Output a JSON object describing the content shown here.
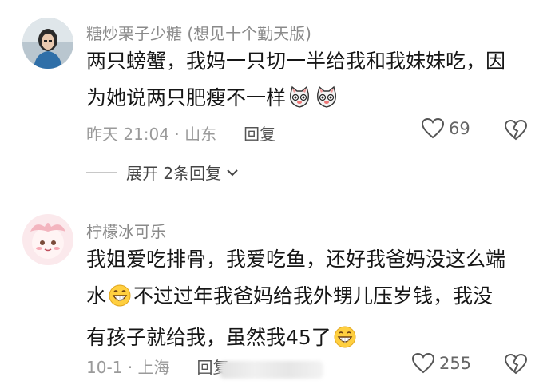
{
  "comments": [
    {
      "author": "糖炒栗子少糖 (想见十个勤天版)",
      "text_line1": "两只螃蟹，我妈一只切一半给我和我妹妹吃，因",
      "text_line2": "为她说两只肥瘦不一样",
      "time_location": "昨天 21:04 · 山东",
      "reply_label": "回复",
      "likes": "69",
      "expand_label": "展开 2条回复"
    },
    {
      "author": "柠檬冰可乐",
      "text_line1": "我姐爱吃排骨，我爱吃鱼，还好我爸妈没这么端",
      "text_line2a": "水",
      "text_line2b": "不过过年我爸妈给我外甥儿压岁钱，我没",
      "text_line3": "有孩子就给我，虽然我45了",
      "time_location": "10-1 · 上海",
      "reply_label": "回复",
      "likes": "255"
    }
  ],
  "icons": {
    "heart": "heart-outline-icon",
    "broken_heart": "broken-heart-icon",
    "chevron": "chevron-down-icon",
    "cat_emoji": "cat-face-emoji",
    "grin_emoji": "grinning-face-emoji"
  }
}
